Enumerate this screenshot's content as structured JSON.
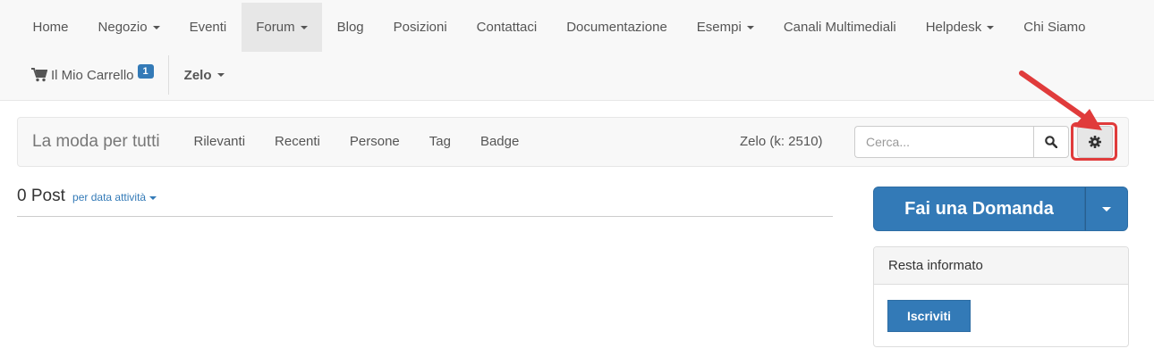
{
  "navbar": {
    "items": [
      {
        "label": "Home",
        "dropdown": false,
        "active": false
      },
      {
        "label": "Negozio",
        "dropdown": true,
        "active": false
      },
      {
        "label": "Eventi",
        "dropdown": false,
        "active": false
      },
      {
        "label": "Forum",
        "dropdown": true,
        "active": true
      },
      {
        "label": "Blog",
        "dropdown": false,
        "active": false
      },
      {
        "label": "Posizioni",
        "dropdown": false,
        "active": false
      },
      {
        "label": "Contattaci",
        "dropdown": false,
        "active": false
      },
      {
        "label": "Documentazione",
        "dropdown": false,
        "active": false
      },
      {
        "label": "Esempi",
        "dropdown": true,
        "active": false
      },
      {
        "label": "Canali Multimediali",
        "dropdown": false,
        "active": false
      },
      {
        "label": "Helpdesk",
        "dropdown": true,
        "active": false
      },
      {
        "label": "Chi Siamo",
        "dropdown": false,
        "active": false
      }
    ],
    "cart": {
      "label": "Il Mio Carrello",
      "count": "1",
      "icon": "shopping-cart-icon"
    },
    "user": {
      "label": "Zelo"
    }
  },
  "forum": {
    "title": "La moda per tutti",
    "links": [
      "Rilevanti",
      "Recenti",
      "Persone",
      "Tag",
      "Badge"
    ],
    "karma": "Zelo (k: 2510)",
    "search_placeholder": "Cerca...",
    "search_icon": "search-icon",
    "settings_icon": "gear-icon"
  },
  "main": {
    "posts_count": "0 Post",
    "sort_label": "per data attività"
  },
  "sidebar": {
    "ask_button": "Fai una Domanda",
    "panel_title": "Resta informato",
    "subscribe_button": "Iscriviti"
  },
  "colors": {
    "primary": "#337ab7",
    "annotation": "#e03b3b"
  }
}
